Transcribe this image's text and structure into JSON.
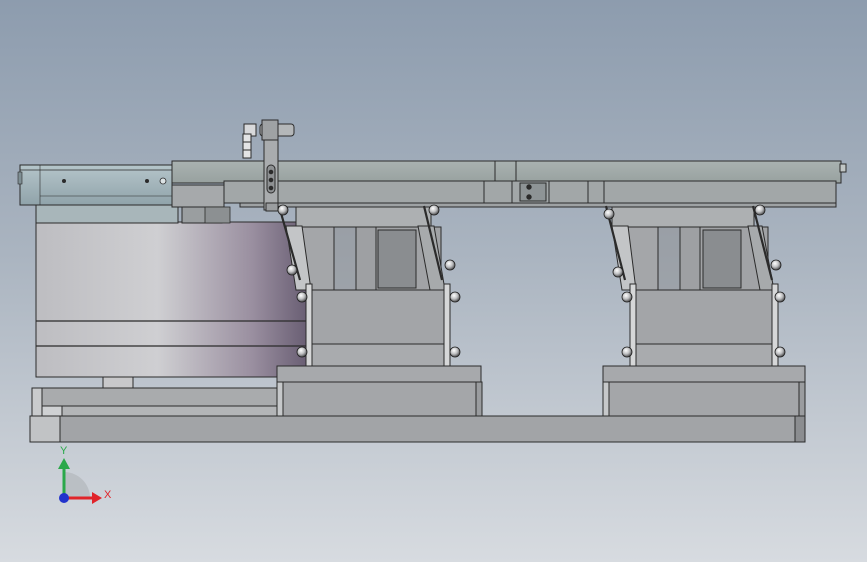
{
  "viewport": {
    "background_top": "#8d9cae",
    "background_bottom": "#d7dbe0"
  },
  "triad": {
    "x_label": "X",
    "y_label": "Y",
    "x_color": "#e0242a",
    "y_color": "#2aa84a",
    "z_color": "#2233cc"
  },
  "colors": {
    "steel": "#a6a8ab",
    "steel_dark": "#8e9093",
    "steel_light": "#c2c4c6",
    "plate": "#9fa4a6",
    "rail": "#a3a9a8",
    "bowl_head": "#9fb1b7",
    "bowl_body": "#c9c9cc",
    "bowl_shadow": "#6e6478",
    "outline": "#2b2b2b"
  }
}
